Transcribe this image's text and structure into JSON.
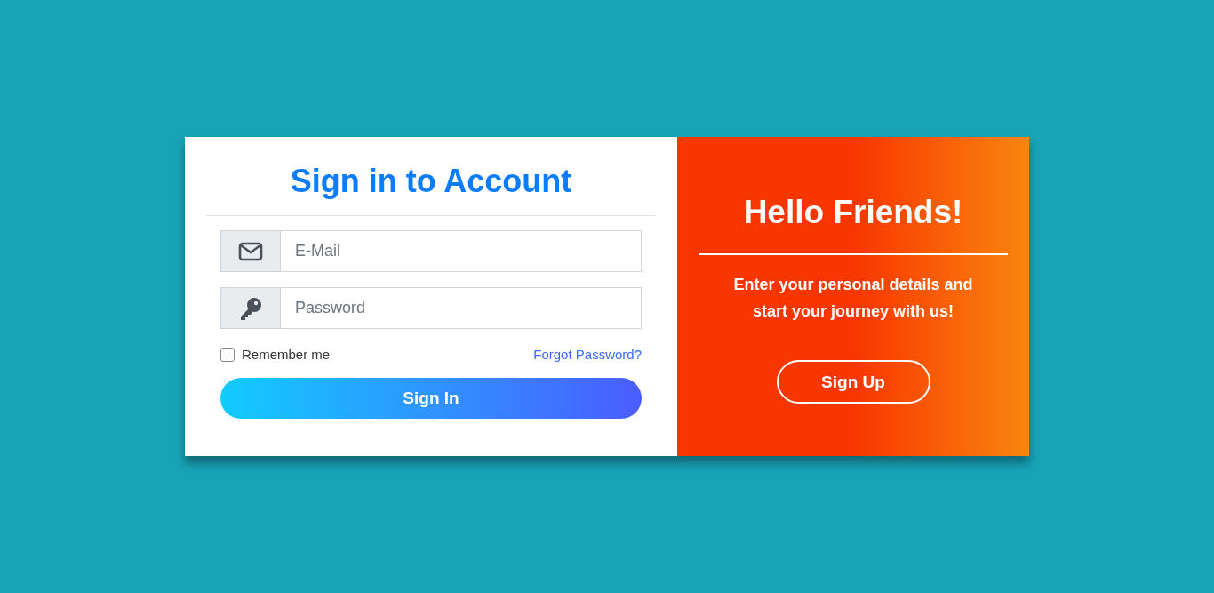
{
  "sign_in": {
    "title": "Sign in to Account",
    "fields": [
      {
        "kind": "email",
        "placeholder": "E-Mail"
      },
      {
        "kind": "password",
        "placeholder": "Password"
      }
    ],
    "remember": {
      "label": "Remember me",
      "checked": false
    },
    "forgot_link": "Forgot Password?",
    "button": "Sign In"
  },
  "welcome": {
    "title": "Hello Friends!",
    "message": "Enter your personal details and start your journey with us!",
    "button": "Sign Up"
  }
}
